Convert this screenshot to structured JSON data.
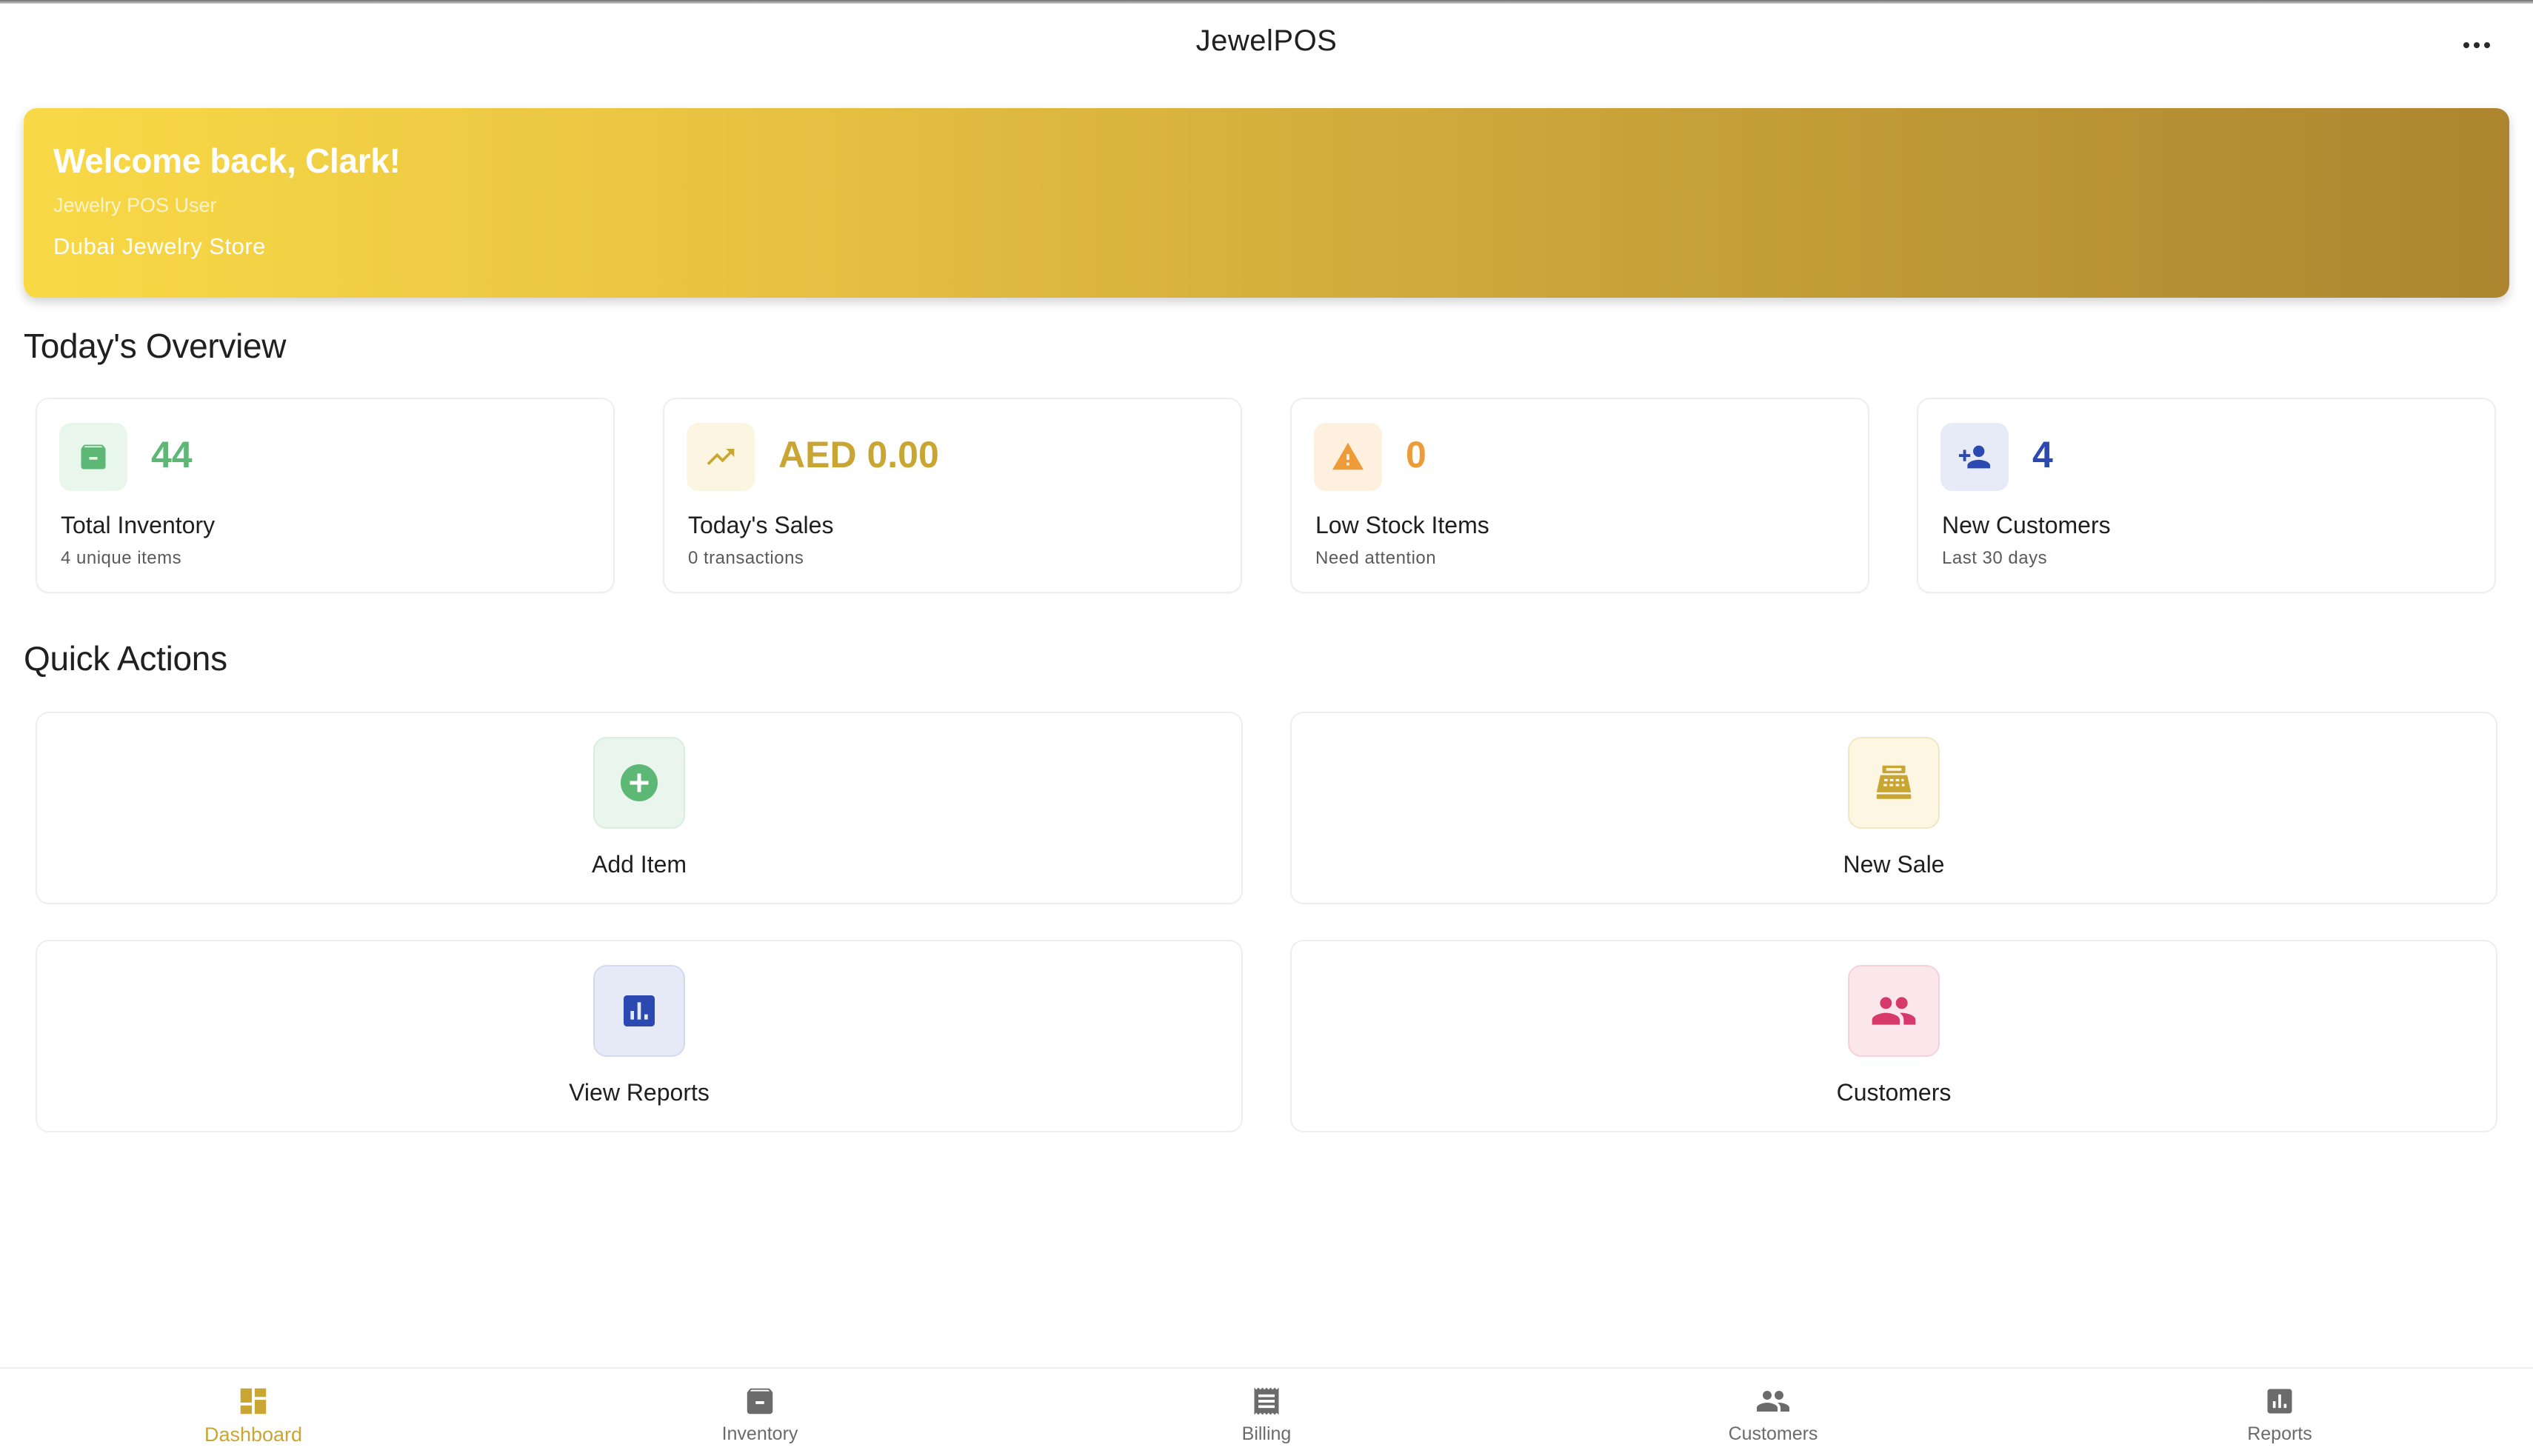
{
  "app": {
    "title": "JewelPOS"
  },
  "banner": {
    "welcome": "Welcome back, Clark!",
    "role": "Jewelry POS User",
    "store": "Dubai Jewelry Store"
  },
  "overview": {
    "title": "Today's Overview",
    "cards": [
      {
        "value": "44",
        "label": "Total Inventory",
        "sub": "4 unique items",
        "icon": "archive-icon",
        "color": "#5cb874",
        "bg": "#e9f6ec"
      },
      {
        "value": "AED 0.00",
        "label": "Today's Sales",
        "sub": "0 transactions",
        "icon": "trending-up-icon",
        "color": "#c9a534",
        "bg": "#fbf5e2"
      },
      {
        "value": "0",
        "label": "Low Stock Items",
        "sub": "Need attention",
        "icon": "warning-icon",
        "color": "#ee9c3a",
        "bg": "#fdf0df"
      },
      {
        "value": "4",
        "label": "New Customers",
        "sub": "Last 30 days",
        "icon": "person-add-icon",
        "color": "#2b49b1",
        "bg": "#e7ebf8"
      }
    ]
  },
  "quick_actions": {
    "title": "Quick Actions",
    "items": [
      {
        "label": "Add Item",
        "icon": "add-circle-icon",
        "color": "#5cb874",
        "bg": "#eaf6ed"
      },
      {
        "label": "New Sale",
        "icon": "cash-register-icon",
        "color": "#c9a534",
        "bg": "#fcf6e3"
      },
      {
        "label": "View Reports",
        "icon": "bar-chart-icon",
        "color": "#2b49b1",
        "bg": "#e6eaf7"
      },
      {
        "label": "Customers",
        "icon": "people-icon",
        "color": "#d63a6b",
        "bg": "#fbe6ec"
      }
    ]
  },
  "nav": {
    "active_color": "#c9a534",
    "inactive_color": "#6b6b6b",
    "items": [
      {
        "label": "Dashboard",
        "icon": "dashboard-icon",
        "active": true
      },
      {
        "label": "Inventory",
        "icon": "archive-icon",
        "active": false
      },
      {
        "label": "Billing",
        "icon": "receipt-icon",
        "active": false
      },
      {
        "label": "Customers",
        "icon": "people-icon",
        "active": false
      },
      {
        "label": "Reports",
        "icon": "bar-chart-icon",
        "active": false
      }
    ]
  }
}
